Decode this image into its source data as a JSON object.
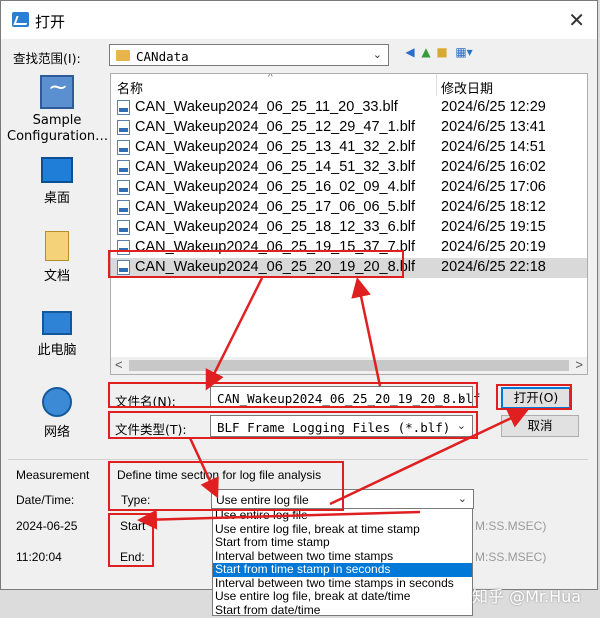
{
  "window": {
    "title": "打开",
    "close_glyph": "✕"
  },
  "lookin": {
    "label": "查找范围(I):",
    "value": "CANdata",
    "arrow": "⌄"
  },
  "toolbar": {
    "icons": [
      "back-icon",
      "up-folder-icon",
      "new-folder-icon",
      "view-menu-icon"
    ]
  },
  "places": [
    {
      "label": "Sample Configuration…",
      "icon": "sample-config-icon"
    },
    {
      "label": "桌面",
      "icon": "desktop-icon"
    },
    {
      "label": "文档",
      "icon": "documents-icon"
    },
    {
      "label": "此电脑",
      "icon": "this-pc-icon"
    },
    {
      "label": "网络",
      "icon": "network-icon"
    }
  ],
  "filelist": {
    "col_name": "名称",
    "col_date": "修改日期",
    "files": [
      {
        "name": "CAN_Wakeup2024_06_25_11_20_33.blf",
        "date": "2024/6/25 12:29"
      },
      {
        "name": "CAN_Wakeup2024_06_25_12_29_47_1.blf",
        "date": "2024/6/25 13:41"
      },
      {
        "name": "CAN_Wakeup2024_06_25_13_41_32_2.blf",
        "date": "2024/6/25 14:51"
      },
      {
        "name": "CAN_Wakeup2024_06_25_14_51_32_3.blf",
        "date": "2024/6/25 16:02"
      },
      {
        "name": "CAN_Wakeup2024_06_25_16_02_09_4.blf",
        "date": "2024/6/25 17:06"
      },
      {
        "name": "CAN_Wakeup2024_06_25_17_06_06_5.blf",
        "date": "2024/6/25 18:12"
      },
      {
        "name": "CAN_Wakeup2024_06_25_18_12_33_6.blf",
        "date": "2024/6/25 19:15"
      },
      {
        "name": "CAN_Wakeup2024_06_25_19_15_37_7.blf",
        "date": "2024/6/25 20:19"
      },
      {
        "name": "CAN_Wakeup2024_06_25_20_19_20_8.blf",
        "date": "2024/6/25 22:18"
      }
    ],
    "selected_index": 8
  },
  "filename": {
    "label": "文件名(N):",
    "value": "CAN_Wakeup2024_06_25_20_19_20_8.blf"
  },
  "filetype": {
    "label": "文件类型(T):",
    "value": "BLF Frame Logging Files (*.blf)"
  },
  "buttons": {
    "open": "打开(O)",
    "cancel": "取消"
  },
  "measurement": {
    "title": "Measurement",
    "datetime_label": "Date/Time:",
    "date": "2024-06-25",
    "time": "11:20:04"
  },
  "timesection": {
    "title": "Define time section for log file analysis",
    "type_label": "Type:",
    "type_value": "Use entire log file",
    "start_label": "Start",
    "end_label": "End:",
    "format_hint_1": "M:SS.MSEC)",
    "format_hint_2": "M:SS.MSEC)",
    "options": [
      "Use entire log file",
      "Use entire log file, break at time stamp",
      "Start from time stamp",
      "Interval between two time stamps",
      "Start from time stamp in seconds",
      "Interval between two time stamps in seconds",
      "Use entire log file, break at date/time",
      "Start from date/time"
    ],
    "highlighted_index": 4
  },
  "watermark": "知乎 @Mr.Hua",
  "colors": {
    "annotation_red": "#e02020",
    "highlight_blue": "#0078d7"
  }
}
